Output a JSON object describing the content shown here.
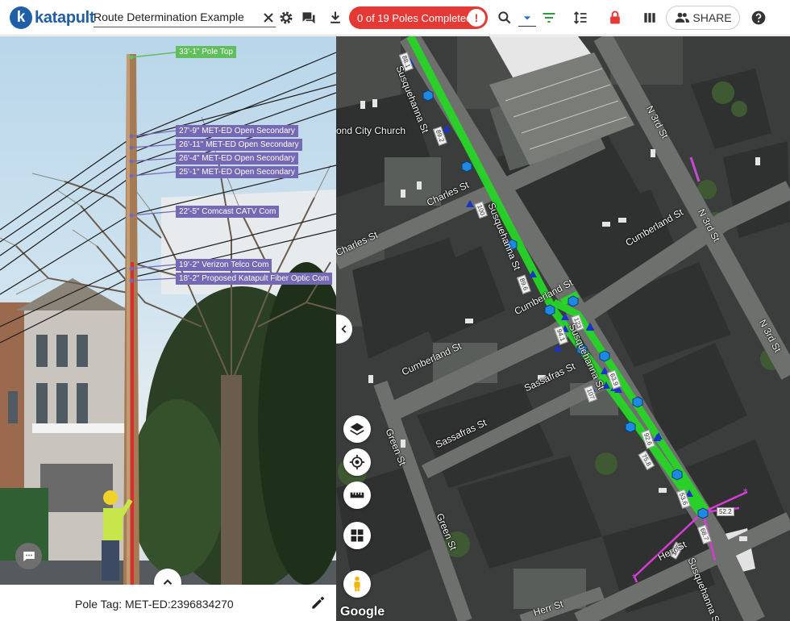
{
  "header": {
    "logo_mark": "k",
    "logo_text": "katapult",
    "job_name": "Route Determination Example",
    "poles_status": "0 of 19 Poles Completed",
    "poles_info": "!",
    "share_label": "SHARE",
    "accent_color": "#e53935",
    "brand_color": "#1f5fa8",
    "icons": [
      "close-icon",
      "gear-icon",
      "comments-icon",
      "download-icon",
      "info-icon",
      "search-icon",
      "dropdown-icon",
      "filter-icon",
      "sort-icon",
      "lock-icon",
      "columns-icon",
      "share-icon",
      "help-icon"
    ]
  },
  "photo": {
    "labels": {
      "pole_top": "33'-1\" Pole Top",
      "sec1": "27'-9\" MET-ED Open Secondary",
      "sec2": "26'-11\" MET-ED Open Secondary",
      "sec3": "26'-4\" MET-ED Open Secondary",
      "sec4": "25'-1\" MET-ED Open Secondary",
      "catv": "22'-5\" Comcast CATV Com",
      "telco": "19'-2\" Verizon Telco Com",
      "fiber": "18'-2\" Proposed Katapult Fiber Optic Com"
    },
    "pole_tag": "Pole Tag: MET-ED:2396834270"
  },
  "map": {
    "streets": {
      "susq_top": "Susquehanna St",
      "susq_mid": "Susquehanna St",
      "susq_low": "Susquehanna St",
      "susq_bottom": "Susquehanna St",
      "charles1": "Charles St",
      "charles2": "Charles St",
      "cumberland1": "Cumberland St",
      "cumberland2": "Cumberland St",
      "cumberland3": "Cumberland St",
      "sassafras1": "Sassafras St",
      "sassafras2": "Sassafras St",
      "green1": "Green St",
      "green2": "Green St",
      "herr1": "Herr St",
      "herr2": "Herr St",
      "n3rd1": "N 3rd St",
      "n3rd2": "N 3rd St",
      "n3rd3": "N 3rd St",
      "church": "ond City Church"
    },
    "segments": [
      "88.1",
      "89.2",
      "100",
      "89.6",
      "94.1",
      "123",
      "107",
      "63.9",
      "92.6",
      "75.8",
      "53.6",
      "52.2",
      "68.7",
      "105"
    ],
    "attribution": "Google",
    "route_color": "#27d427",
    "pole_color": "#1e88e5",
    "branch_color": "#d63cd6"
  }
}
